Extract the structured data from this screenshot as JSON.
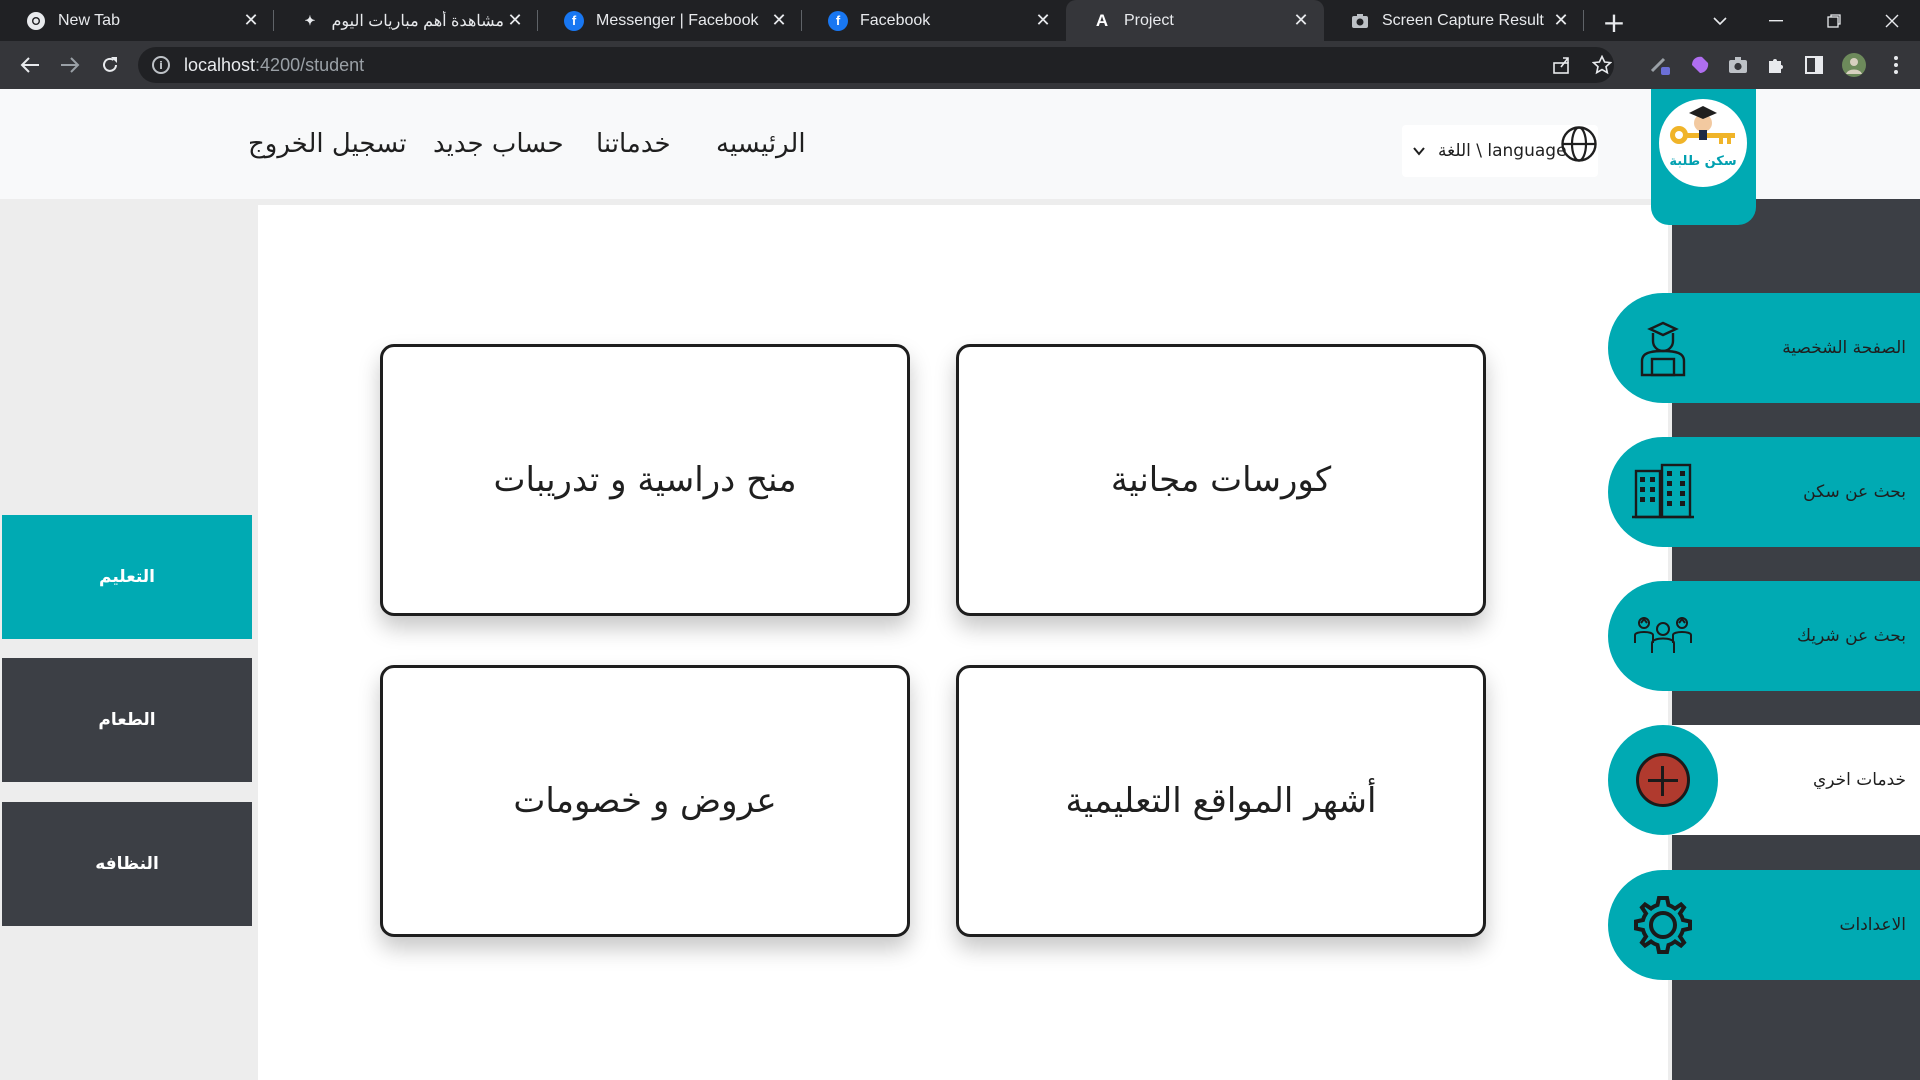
{
  "browser": {
    "tabs": [
      {
        "title": "New Tab",
        "icon": "chrome-icon"
      },
      {
        "title": "مشاهدة أهم مباريات اليوم | أ",
        "icon": "site-icon"
      },
      {
        "title": "Messenger | Facebook",
        "icon": "facebook-icon"
      },
      {
        "title": "Facebook",
        "icon": "facebook-icon"
      },
      {
        "title": "Project",
        "icon": "angular-icon"
      },
      {
        "title": "Screen Capture Result",
        "icon": "camera-icon"
      }
    ],
    "active_tab": "Project",
    "url_host": "localhost",
    "url_rest": ":4200/student"
  },
  "navbar": {
    "links": [
      "الرئيسيه",
      "خدماتنا",
      "حساب جديد",
      "تسجيل الخروج"
    ],
    "language_label": "اللغة \\ language"
  },
  "logo": {
    "caption": "سكن طلبة"
  },
  "left_menu": {
    "items": [
      {
        "label": "التعليم",
        "active": true
      },
      {
        "label": "الطعام",
        "active": false
      },
      {
        "label": "النظافه",
        "active": false
      }
    ]
  },
  "cards": [
    {
      "label": "كورسات مجانية"
    },
    {
      "label": "منح دراسية و تدريبات"
    },
    {
      "label": "أشهر المواقع التعليمية"
    },
    {
      "label": "عروض و خصومات"
    }
  ],
  "right_menu": {
    "items": [
      {
        "label": "الصفحة الشخصية",
        "icon": "student-icon"
      },
      {
        "label": "بحث عن سكن",
        "icon": "building-icon"
      },
      {
        "label": "بحث عن شريك",
        "icon": "group-icon"
      },
      {
        "label": "خدمات اخري",
        "icon": "plus-icon"
      },
      {
        "label": "الاعدادات",
        "icon": "gear-icon"
      }
    ]
  },
  "colors": {
    "accent": "#00aab3",
    "dark": "#3c3f45",
    "plus_red": "#b03a2e"
  }
}
